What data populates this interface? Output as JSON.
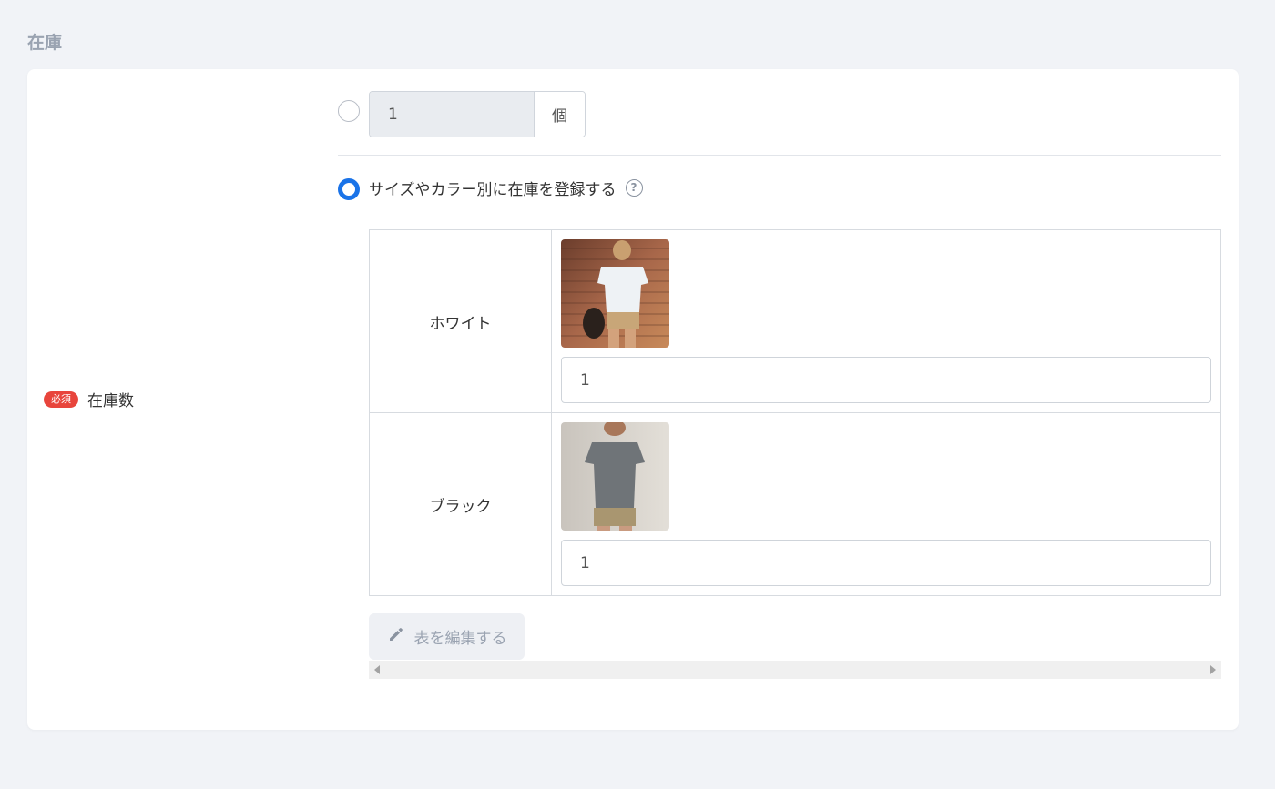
{
  "section": {
    "title": "在庫"
  },
  "field": {
    "required_badge": "必須",
    "label": "在庫数"
  },
  "single_stock": {
    "value": "1",
    "unit": "個"
  },
  "variant": {
    "label": "サイズやカラー別に在庫を登録する",
    "help_icon": "?",
    "rows": [
      {
        "name": "ホワイト",
        "stock": "1"
      },
      {
        "name": "ブラック",
        "stock": "1"
      }
    ]
  },
  "actions": {
    "edit_table": "表を編集する"
  },
  "colors": {
    "accent": "#1a73e8",
    "required": "#e8453c"
  },
  "icons": [
    "help-icon",
    "pencil-icon",
    "scroll-left-icon",
    "scroll-right-icon"
  ]
}
